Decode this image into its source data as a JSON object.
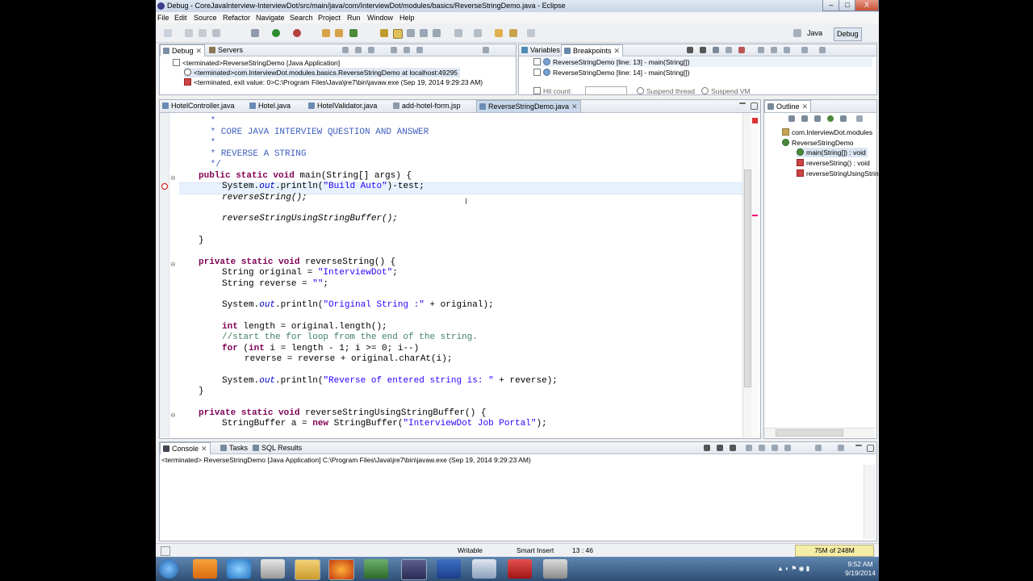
{
  "window": {
    "title": "Debug - CoreJavaInterview-InterviewDot/src/main/java/com/InterviewDot/modules/basics/ReverseStringDemo.java - Eclipse",
    "minimize": "–",
    "maximize": "□",
    "close": "X"
  },
  "menu": [
    "File",
    "Edit",
    "Source",
    "Refactor",
    "Navigate",
    "Search",
    "Project",
    "Run",
    "Window",
    "Help"
  ],
  "perspectives": {
    "java": "Java",
    "debug": "Debug"
  },
  "debug_view": {
    "tabs": [
      "Debug",
      "Servers"
    ],
    "items": [
      "<terminated>ReverseStringDemo [Java Application]",
      "<terminated>com.InterviewDot.modules.basics.ReverseStringDemo at localhost:49295",
      "<terminated, exit value: 0>C:\\Program Files\\Java\\jre7\\bin\\javaw.exe (Sep 19, 2014 9:29:23 AM)"
    ]
  },
  "breakpoints_view": {
    "tabs": [
      "Variables",
      "Breakpoints"
    ],
    "items": [
      "ReverseStringDemo [line: 13] - main(String[])",
      "ReverseStringDemo [line: 14] - main(String[])"
    ],
    "extras": [
      "Hit count:",
      "Suspend thread",
      "Suspend VM"
    ]
  },
  "editor": {
    "tabs": [
      "HotelController.java",
      "Hotel.java",
      "HotelValidator.java",
      "add-hotel-form.jsp",
      "ReverseStringDemo.java"
    ],
    "active_tab": 4,
    "lines": {
      "l0": " *",
      "l1": " * CORE JAVA INTERVIEW QUESTION AND ANSWER",
      "l2": " *",
      "l3": " * REVERSE A STRING",
      "l4": " */",
      "l5a": "public static void",
      "l5b": " main(String[] args) {",
      "l6a": "System.",
      "l6b": "out",
      "l6c": ".println(",
      "l6d": "\"Build Auto\"",
      "l6e": ")-test;",
      "l7": "reverseString();",
      "l8": "reverseStringUsingStringBuffer();",
      "l9": "}",
      "l10a": "private static void",
      "l10b": " reverseString() {",
      "l11a": "String original = ",
      "l11b": "\"InterviewDot\"",
      "l11c": ";",
      "l12a": "String reverse = ",
      "l12b": "\"\"",
      "l12c": ";",
      "l13a": "System.",
      "l13b": "out",
      "l13c": ".println(",
      "l13d": "\"Original String :\"",
      "l13e": " + original);",
      "l14a": "int",
      "l14b": " length = original.length();",
      "l15": "//start the for loop from the end of the string.",
      "l16a": "for",
      "l16b": " (",
      "l16c": "int",
      "l16d": " i = length - 1; i >= 0; i--)",
      "l17": "reverse = reverse + original.charAt(i);",
      "l18a": "System.",
      "l18b": "out",
      "l18c": ".println(",
      "l18d": "\"Reverse of entered string is: \"",
      "l18e": " + reverse);",
      "l19": "}",
      "l20a": "private static void",
      "l20b": " reverseStringUsingStringBuffer() {",
      "l21a": "StringBuffer a = ",
      "l21b": "new",
      "l21c": " StringBuffer(",
      "l21d": "\"InterviewDot Job Portal\"",
      "l21e": ");"
    }
  },
  "outline": {
    "tab": "Outline",
    "items": [
      "com.InterviewDot.modules",
      "ReverseStringDemo",
      "main(String[]) : void",
      "reverseString() : void",
      "reverseStringUsingStrin"
    ]
  },
  "console": {
    "tabs": [
      "Console",
      "Tasks",
      "SQL Results"
    ],
    "status": "<terminated> ReverseStringDemo [Java Application] C:\\Program Files\\Java\\jre7\\bin\\javaw.exe (Sep 19, 2014 9:29:23 AM)"
  },
  "statusbar": {
    "writable": "Writable",
    "insert": "Smart Insert",
    "position": "13 : 46",
    "heap": "75M of 248M"
  },
  "taskbar": {
    "time": "9:52 AM",
    "date": "9/19/2014"
  }
}
